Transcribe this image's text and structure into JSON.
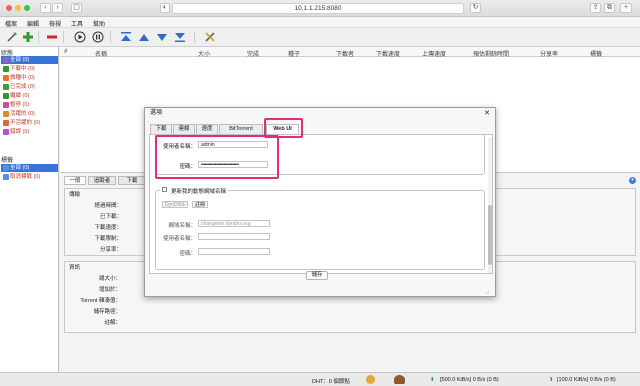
{
  "browser": {
    "address": "10.1.1.215:8080"
  },
  "menu": [
    "檔案",
    "編輯",
    "檢視",
    "工具",
    "幫助"
  ],
  "sidebar": {
    "status_heading": "狀態",
    "status_items": [
      {
        "label": "全部 (0)",
        "color": "#8a66cc"
      },
      {
        "label": "下載中 (0)",
        "color": "#2c9a2c"
      },
      {
        "label": "做種中 (0)",
        "color": "#e07a1b"
      },
      {
        "label": "已完成 (0)",
        "color": "#3c9c3c"
      },
      {
        "label": "繼續 (0)",
        "color": "#3b8c3b"
      },
      {
        "label": "暫停 (0)",
        "color": "#d24c9a"
      },
      {
        "label": "活躍的 (0)",
        "color": "#d48c2a"
      },
      {
        "label": "不活躍的 (0)",
        "color": "#d96b3a"
      },
      {
        "label": "錯誤 (0)",
        "color": "#b44fd6"
      }
    ],
    "label_heading": "標籤",
    "label_items": [
      {
        "label": "全部 (0)"
      },
      {
        "label": "取消標籤 (0)"
      }
    ]
  },
  "table": {
    "columns": [
      "#",
      "名稱",
      "大小",
      "完成",
      "種子",
      "下載者",
      "下載速度",
      "上傳速度",
      "預估剩餘時間",
      "分享率",
      "標籤"
    ]
  },
  "lower": {
    "tabs": [
      "一般",
      "追蹤者",
      "下載"
    ],
    "transfer_title": "傳輸",
    "transfer_fields": [
      "經過時間：",
      "已下載：",
      "下載速度：",
      "下載限制：",
      "分享率："
    ],
    "info_title": "資訊",
    "info_fields": [
      "總大小：",
      "增加於：",
      "Torrent 雜湊值：",
      "儲存路徑：",
      "註解："
    ]
  },
  "status": {
    "dht": "DHT：0 個節點",
    "down": "[500.0 KiB/s] 0 B/s (0 B)",
    "up": "[100.0 KiB/s] 0 B/s (0 B)"
  },
  "dialog": {
    "title": "選項",
    "tabs": [
      "下載",
      "連線",
      "速度",
      "BitTorrent",
      "Web UI"
    ],
    "auth": {
      "user_label": "使用者名稱：",
      "user_value": "admin",
      "pass_label": "密碼：",
      "pass_value": "••••••••••••••••••••••••••••••"
    },
    "ddns": {
      "checkbox_label": "更新我的動態網域名稱",
      "service": "DynDNS",
      "register": "註冊",
      "domain_label": "網域名稱：",
      "domain_placeholder": "changeme.dyndns.org",
      "user_label": "使用者名稱：",
      "pass_label": "密碼："
    },
    "save": "儲存"
  },
  "colors": {
    "highlight": "#e62b7d",
    "selection": "#3874d8"
  }
}
